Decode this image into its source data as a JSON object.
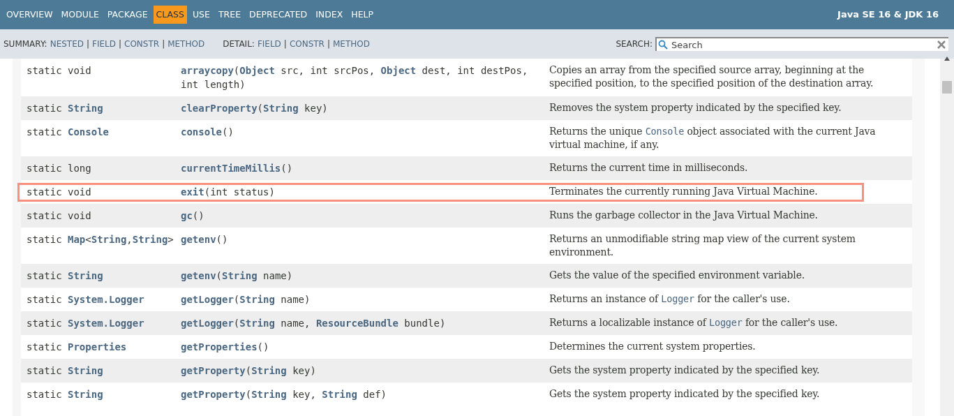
{
  "top_nav": {
    "items": [
      {
        "label": "OVERVIEW",
        "selected": false
      },
      {
        "label": "MODULE",
        "selected": false
      },
      {
        "label": "PACKAGE",
        "selected": false
      },
      {
        "label": "CLASS",
        "selected": true
      },
      {
        "label": "USE",
        "selected": false
      },
      {
        "label": "TREE",
        "selected": false
      },
      {
        "label": "DEPRECATED",
        "selected": false
      },
      {
        "label": "INDEX",
        "selected": false
      },
      {
        "label": "HELP",
        "selected": false
      }
    ],
    "title": "Java SE 16 & JDK 16"
  },
  "sub_nav": {
    "groups": [
      {
        "label": "SUMMARY:",
        "items": [
          {
            "kind": "link",
            "text": "NESTED"
          },
          {
            "kind": "sep",
            "text": "|"
          },
          {
            "kind": "link",
            "text": "FIELD"
          },
          {
            "kind": "sep",
            "text": "|"
          },
          {
            "kind": "link",
            "text": "CONSTR"
          },
          {
            "kind": "sep",
            "text": "|"
          },
          {
            "kind": "link",
            "text": "METHOD"
          }
        ]
      },
      {
        "label": "DETAIL:",
        "items": [
          {
            "kind": "link",
            "text": "FIELD"
          },
          {
            "kind": "sep",
            "text": "|"
          },
          {
            "kind": "link",
            "text": "CONSTR"
          },
          {
            "kind": "sep",
            "text": "|"
          },
          {
            "kind": "link",
            "text": "METHOD"
          }
        ]
      }
    ],
    "search": {
      "label": "SEARCH:",
      "placeholder": "Search"
    }
  },
  "table": {
    "rows": [
      {
        "type": "static void",
        "method": "**arraycopy**(**Object** src, int srcPos, **Object** dest, int destPos, int length)",
        "description": [
          {
            "kind": "text",
            "text": "Copies an array from the specified source array, beginning at the specified position, to the specified position of the destination array."
          }
        ],
        "highlighted": false
      },
      {
        "type": "static **String**",
        "method": "**clearProperty**(**String** key)",
        "description": [
          {
            "kind": "text",
            "text": "Removes the system property indicated by the specified key."
          }
        ],
        "highlighted": false
      },
      {
        "type": "static **Console**",
        "method": "**console**()",
        "description": [
          {
            "kind": "text",
            "text": "Returns the unique "
          },
          {
            "kind": "code",
            "text": "Console"
          },
          {
            "kind": "text",
            "text": " object associated with the current Java virtual machine, if any."
          }
        ],
        "highlighted": false
      },
      {
        "type": "static long",
        "method": "**currentTimeMillis**()",
        "description": [
          {
            "kind": "text",
            "text": "Returns the current time in milliseconds."
          }
        ],
        "highlighted": false
      },
      {
        "type": "static void",
        "method": "**exit**(int status)",
        "description": [
          {
            "kind": "text",
            "text": "Terminates the currently running Java Virtual Machine."
          }
        ],
        "highlighted": true
      },
      {
        "type": "static void",
        "method": "**gc**()",
        "description": [
          {
            "kind": "text",
            "text": "Runs the garbage collector in the Java Virtual Machine."
          }
        ],
        "highlighted": false
      },
      {
        "type": "static **Map**<**String**,**String**>",
        "method": "**getenv**()",
        "description": [
          {
            "kind": "text",
            "text": "Returns an unmodifiable string map view of the current system environment."
          }
        ],
        "highlighted": false
      },
      {
        "type": "static **String**",
        "method": "**getenv**(**String** name)",
        "description": [
          {
            "kind": "text",
            "text": "Gets the value of the specified environment variable."
          }
        ],
        "highlighted": false
      },
      {
        "type": "static **System.Logger**",
        "method": "**getLogger**(**String** name)",
        "description": [
          {
            "kind": "text",
            "text": "Returns an instance of "
          },
          {
            "kind": "code",
            "text": "Logger"
          },
          {
            "kind": "text",
            "text": " for the caller's use."
          }
        ],
        "highlighted": false
      },
      {
        "type": "static **System.Logger**",
        "method": "**getLogger**(**String** name, **ResourceBundle** bundle)",
        "description": [
          {
            "kind": "text",
            "text": "Returns a localizable instance of "
          },
          {
            "kind": "code",
            "text": "Logger"
          },
          {
            "kind": "text",
            "text": " for the caller's use."
          }
        ],
        "highlighted": false
      },
      {
        "type": "static **Properties**",
        "method": "**getProperties**()",
        "description": [
          {
            "kind": "text",
            "text": "Determines the current system properties."
          }
        ],
        "highlighted": false
      },
      {
        "type": "static **String**",
        "method": "**getProperty**(**String** key)",
        "description": [
          {
            "kind": "text",
            "text": "Gets the system property indicated by the specified key."
          }
        ],
        "highlighted": false
      },
      {
        "type": "static **String**",
        "method": "**getProperty**(**String** key, **String** def)",
        "description": [
          {
            "kind": "text",
            "text": "Gets the system property indicated by the specified key."
          }
        ],
        "highlighted": false
      }
    ]
  }
}
